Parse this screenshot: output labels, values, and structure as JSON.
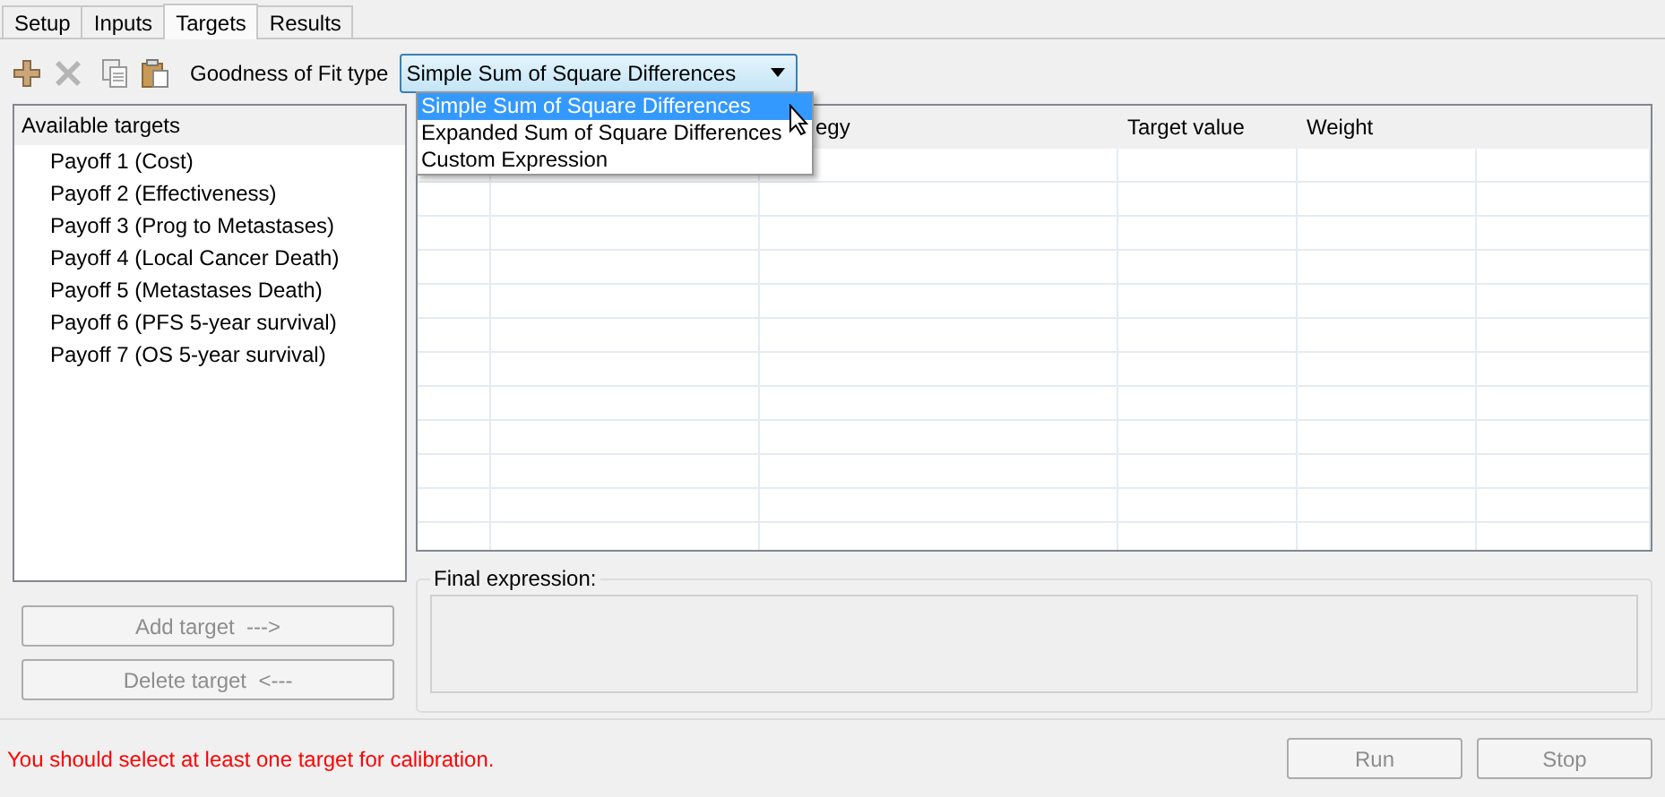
{
  "tabs": [
    {
      "label": "Setup",
      "selected": false
    },
    {
      "label": "Inputs",
      "selected": false
    },
    {
      "label": "Targets",
      "selected": true
    },
    {
      "label": "Results",
      "selected": false
    }
  ],
  "toolbar": {
    "fit_label": "Goodness of Fit type",
    "fit_select": {
      "value": "Simple Sum of Square Differences",
      "expanded": true,
      "options": [
        {
          "label": "Simple Sum of Square Differences",
          "selected": true
        },
        {
          "label": "Expanded Sum of Square Differences",
          "selected": false
        },
        {
          "label": "Custom Expression",
          "selected": false
        }
      ]
    }
  },
  "available_targets": {
    "title": "Available targets",
    "items": [
      "Payoff 1 (Cost)",
      "Payoff 2 (Effectiveness)",
      "Payoff 3 (Prog to Metastases)",
      "Payoff 4 (Local Cancer Death)",
      "Payoff 5 (Metastases Death)",
      "Payoff 6 (PFS 5-year survival)",
      "Payoff 7 (OS 5-year survival)"
    ]
  },
  "target_buttons": [
    {
      "label": "Add target  --->",
      "disabled": true
    },
    {
      "label": "Delete target  <---",
      "disabled": true
    }
  ],
  "table": {
    "column_3": "egy",
    "column_4": "Target value",
    "column_5": "Weight"
  },
  "final_expression": {
    "label": "Final expression:"
  },
  "status": {
    "kind": "error",
    "message": "You should select at least one target for calibration."
  },
  "actions": [
    {
      "label": "Run",
      "disabled": true
    },
    {
      "label": "Stop",
      "disabled": true
    }
  ]
}
